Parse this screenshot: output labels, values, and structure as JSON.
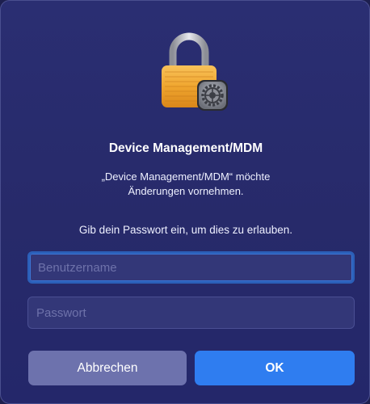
{
  "dialog": {
    "icon": "lock-with-gear-icon",
    "title": "Device Management/MDM",
    "message_line1": "„Device Management/MDM“ möchte",
    "message_line2": "Änderungen vornehmen.",
    "instruction": "Gib dein Passwort ein, um dies zu erlauben."
  },
  "fields": {
    "username": {
      "value": "",
      "placeholder": "Benutzername"
    },
    "password": {
      "value": "",
      "placeholder": "Passwort"
    }
  },
  "buttons": {
    "cancel_label": "Abbrechen",
    "ok_label": "OK"
  },
  "colors": {
    "background": "#2a2e72",
    "primary_button": "#2f7df0",
    "secondary_button": "#6d72ad",
    "focus_ring": "#2b5fb8"
  }
}
